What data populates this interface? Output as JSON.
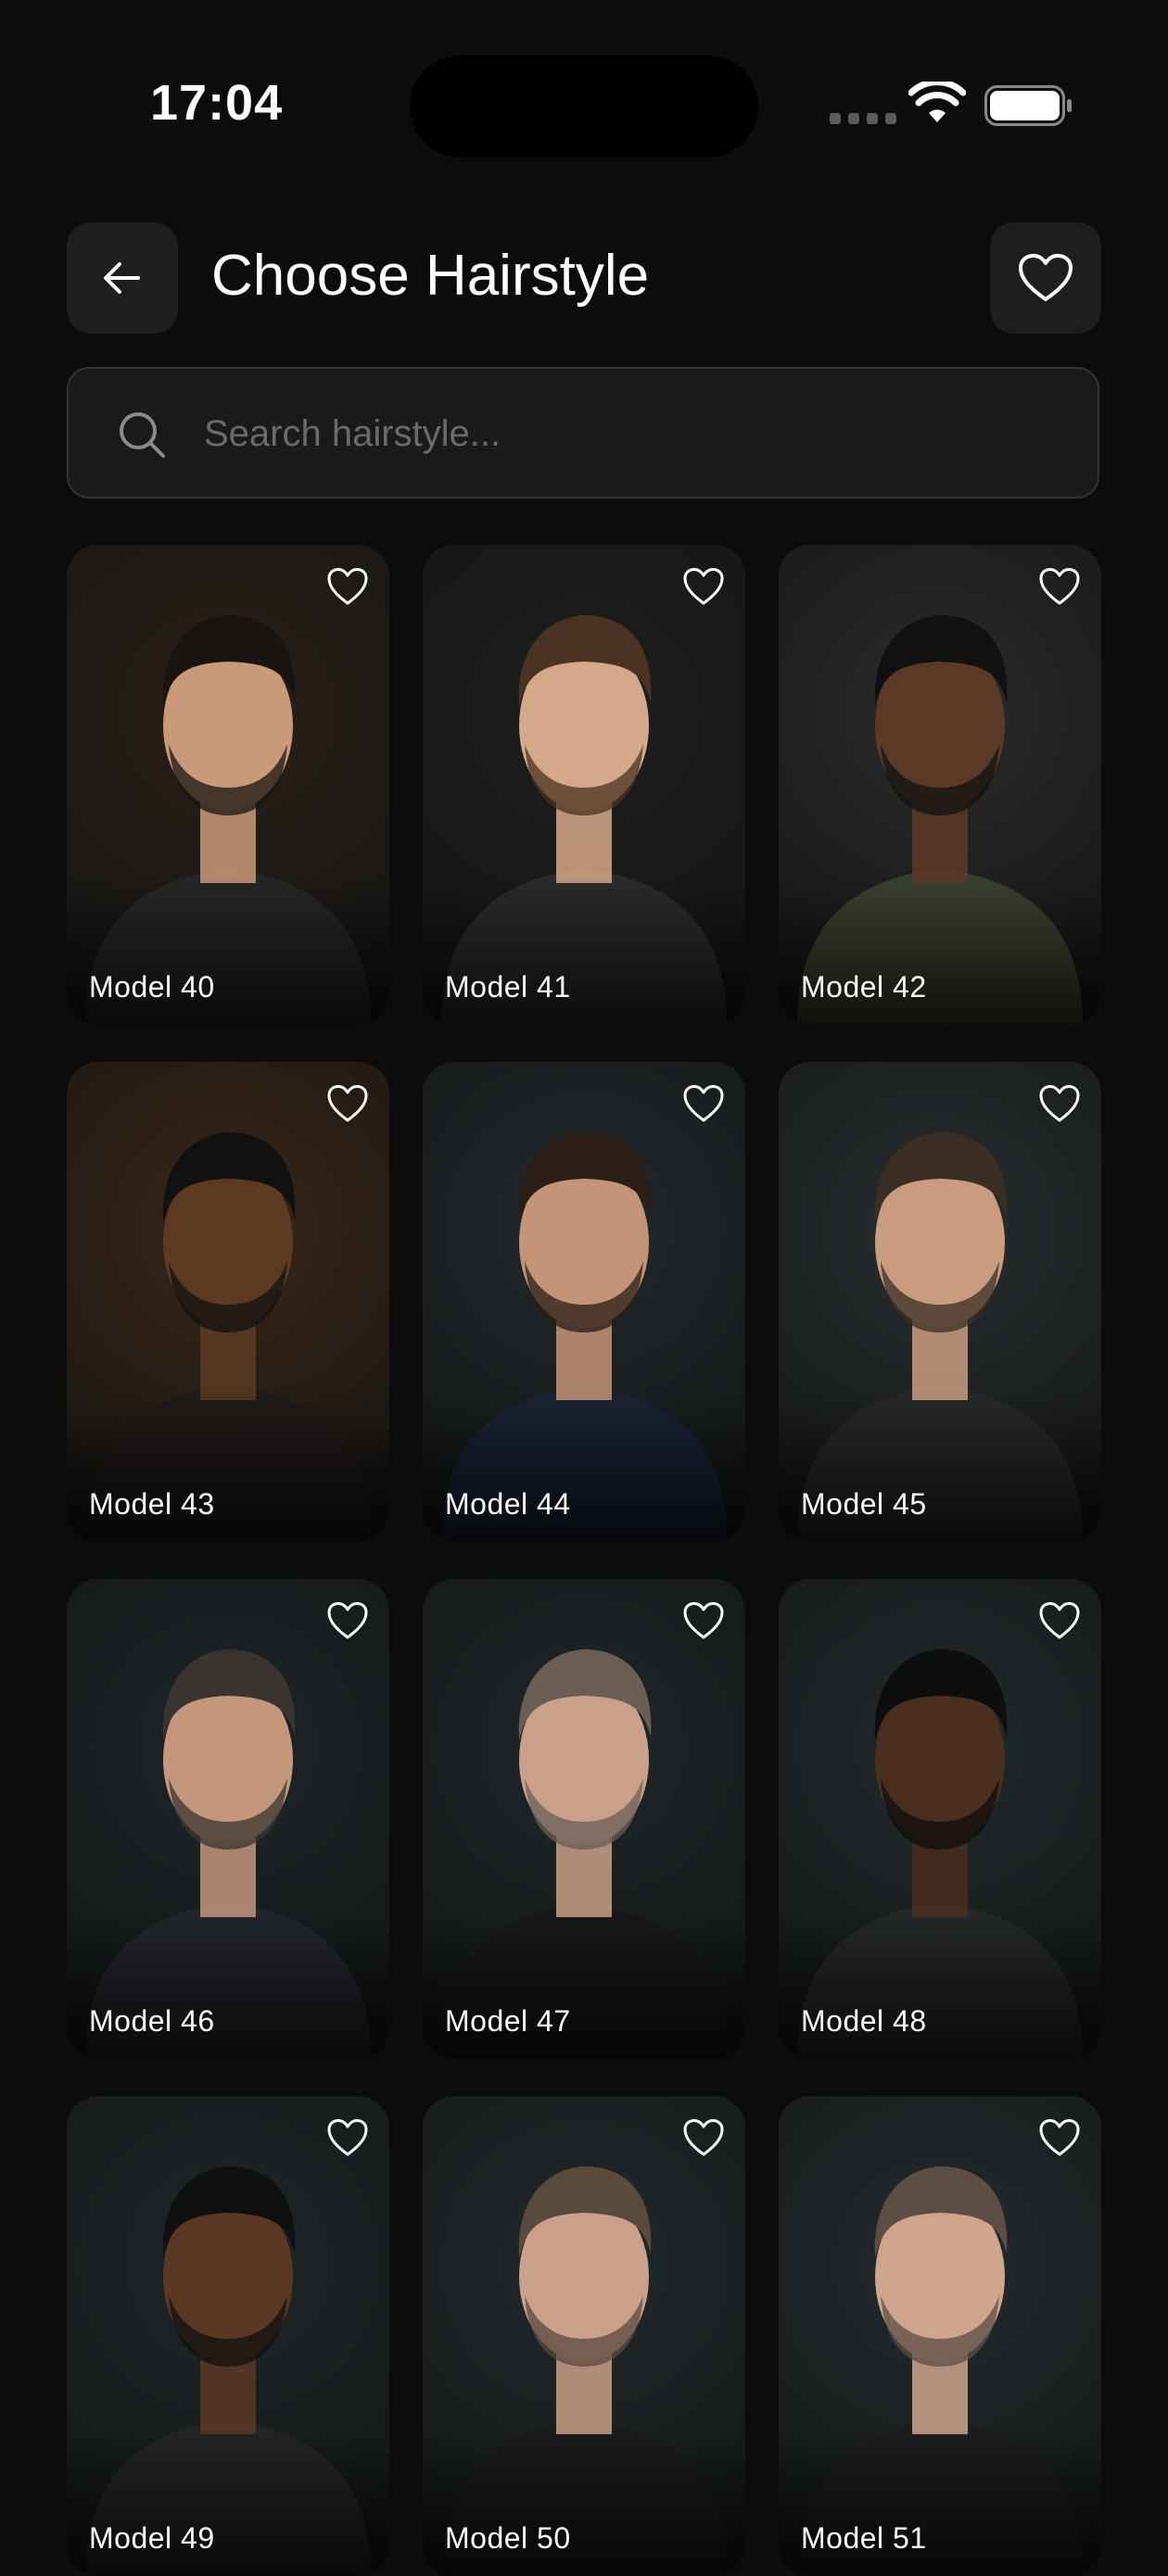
{
  "status_bar": {
    "time": "17:04"
  },
  "header": {
    "title": "Choose Hairstyle",
    "back_icon": "arrow-left-icon",
    "favorites_icon": "heart-outline-icon"
  },
  "search": {
    "placeholder": "Search hairstyle...",
    "value": ""
  },
  "colors": {
    "background": "#0c0c0c",
    "surface": "#1e1e1e",
    "text": "#ffffff",
    "placeholder": "#6a6a6a"
  },
  "models": [
    {
      "label": "Model 40",
      "bg": "#2a2018",
      "hair": "#1a1410",
      "skin": "#c99a7a",
      "shirt": "#262626",
      "fav": false
    },
    {
      "label": "Model 41",
      "bg": "#1e1e1e",
      "hair": "#4a3322",
      "skin": "#d6a88a",
      "shirt": "#2b2b2b",
      "fav": false
    },
    {
      "label": "Model 42",
      "bg": "#2a2c2a",
      "hair": "#111",
      "skin": "#5a3a26",
      "shirt": "#3a4030",
      "fav": false
    },
    {
      "label": "Model 43",
      "bg": "#3a2616",
      "hair": "#111",
      "skin": "#5c3a22",
      "shirt": "#1e1a18",
      "fav": false
    },
    {
      "label": "Model 44",
      "bg": "#23292c",
      "hair": "#2a1e16",
      "skin": "#c49478",
      "shirt": "#1a2233",
      "fav": false
    },
    {
      "label": "Model 45",
      "bg": "#2a2e30",
      "hair": "#3a2e24",
      "skin": "#c99c80",
      "shirt": "#262828",
      "fav": false
    },
    {
      "label": "Model 46",
      "bg": "#1e2628",
      "hair": "#3a3430",
      "skin": "#c4967c",
      "shirt": "#22252a",
      "fav": false
    },
    {
      "label": "Model 47",
      "bg": "#1f2729",
      "hair": "#6a5e54",
      "skin": "#caa08a",
      "shirt": "#181818",
      "fav": false
    },
    {
      "label": "Model 48",
      "bg": "#222a2c",
      "hair": "#0e0e0e",
      "skin": "#4a2e1e",
      "shirt": "#252828",
      "fav": false
    },
    {
      "label": "Model 49",
      "bg": "#1f2729",
      "hair": "#101010",
      "skin": "#5a3824",
      "shirt": "#222426",
      "fav": false
    },
    {
      "label": "Model 50",
      "bg": "#222a2c",
      "hair": "#5a4a3c",
      "skin": "#caa08a",
      "shirt": "#1b1b1b",
      "fav": false
    },
    {
      "label": "Model 51",
      "bg": "#242c2e",
      "hair": "#5c4e44",
      "skin": "#cfa58e",
      "shirt": "#1c1c1c",
      "fav": false
    }
  ]
}
